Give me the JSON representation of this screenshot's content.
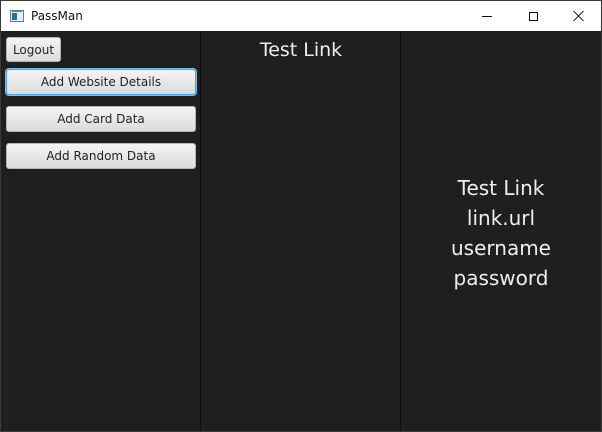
{
  "window": {
    "title": "PassMan",
    "controls": [
      "minimize-icon",
      "maximize-icon",
      "close-icon"
    ]
  },
  "sidebar": {
    "logout_label": "Logout",
    "add_website_label": "Add Website Details",
    "add_card_label": "Add Card Data",
    "add_random_label": "Add Random Data"
  },
  "list": {
    "items": [
      "Test Link"
    ]
  },
  "details": {
    "name": "Test Link",
    "url": "link.url",
    "username": "username",
    "password": "password"
  },
  "colors": {
    "background": "#1f1f1f",
    "text": "#eeeeee",
    "focus_accent": "#4aa3df"
  }
}
